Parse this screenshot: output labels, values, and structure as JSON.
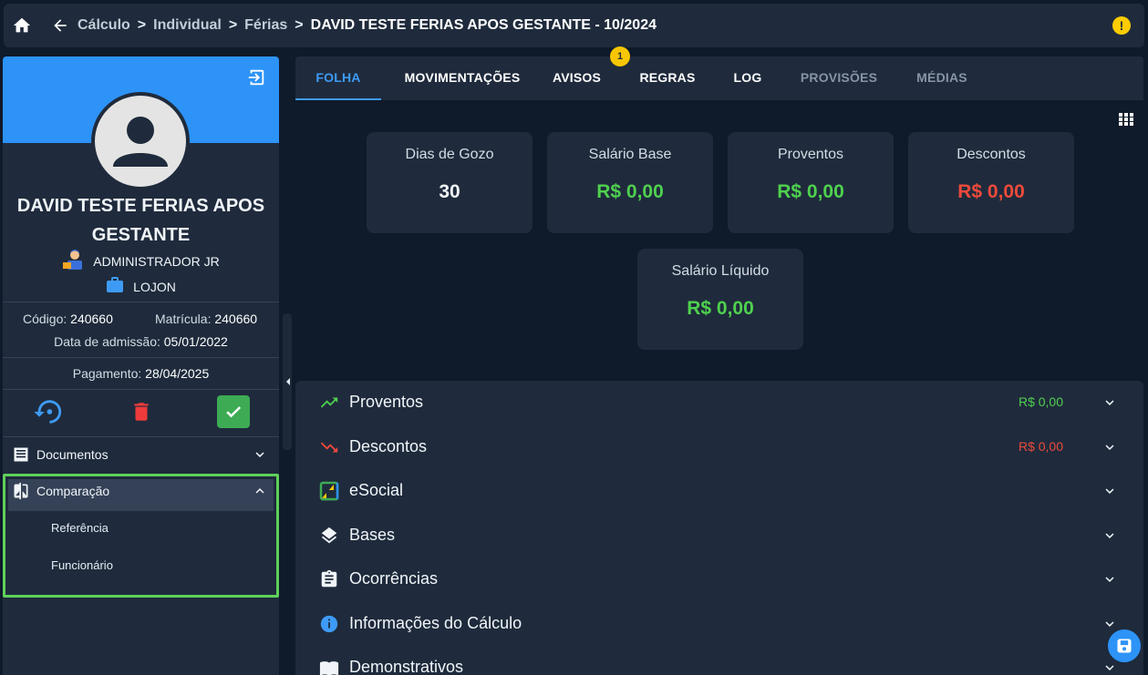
{
  "breadcrumb": {
    "items": [
      "Cálculo",
      "Individual",
      "Férias"
    ],
    "current": "DAVID TESTE FERIAS APOS GESTANTE - 10/2024",
    "separator": ">"
  },
  "alert": {
    "symbol": "!"
  },
  "employee": {
    "name": "DAVID TESTE FERIAS APOS GESTANTE",
    "role": "ADMINISTRADOR JR",
    "store": "LOJON",
    "codigo_label": "Código:",
    "codigo": "240660",
    "matricula_label": "Matrícula:",
    "matricula": "240660",
    "admissao_label": "Data de admissão:",
    "admissao": "05/01/2022",
    "pagamento_label": "Pagamento:",
    "pagamento": "28/04/2025"
  },
  "sidebar_menu": {
    "documentos": "Documentos",
    "comparacao": "Comparação",
    "referencia": "Referência",
    "funcionario": "Funcionário"
  },
  "tabs": [
    "FOLHA",
    "MOVIMENTAÇÕES",
    "AVISOS",
    "REGRAS",
    "LOG",
    "PROVISÕES",
    "MÉDIAS"
  ],
  "avisos_badge": "1",
  "cards": {
    "dias": {
      "label": "Dias de Gozo",
      "value": "30"
    },
    "salario_base": {
      "label": "Salário Base",
      "value": "R$ 0,00"
    },
    "proventos": {
      "label": "Proventos",
      "value": "R$ 0,00"
    },
    "descontos": {
      "label": "Descontos",
      "value": "R$ 0,00"
    },
    "liquido": {
      "label": "Salário Líquido",
      "value": "R$ 0,00"
    }
  },
  "sections": [
    {
      "label": "Proventos",
      "value": "R$ 0,00",
      "icon": "trending-up-icon"
    },
    {
      "label": "Descontos",
      "value": "R$ 0,00",
      "icon": "trending-down-icon"
    },
    {
      "label": "eSocial",
      "value": "",
      "icon": "esocial-icon"
    },
    {
      "label": "Bases",
      "value": "",
      "icon": "layers-icon"
    },
    {
      "label": "Ocorrências",
      "value": "",
      "icon": "clipboard-icon"
    },
    {
      "label": "Informações do Cálculo",
      "value": "",
      "icon": "info-icon"
    },
    {
      "label": "Demonstrativos",
      "value": "",
      "icon": "book-icon"
    }
  ],
  "colors": {
    "accent": "#2d93f7",
    "positive": "#4fd14e",
    "negative": "#ef4a3b",
    "highlight": "#5fd15a",
    "background": "#0f1a2a",
    "surface": "#1f2b3c"
  }
}
